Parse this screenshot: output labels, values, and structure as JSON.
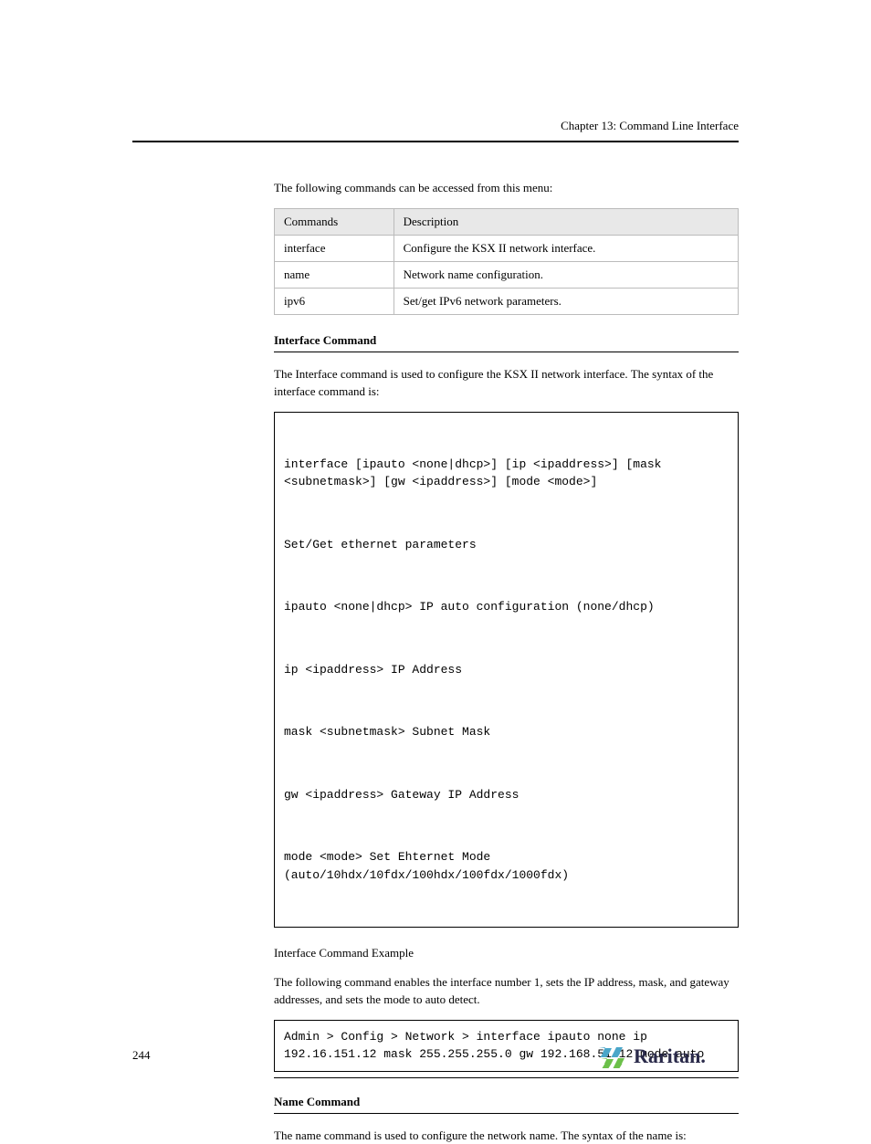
{
  "header": {
    "chapter_line": "Chapter 13: Command Line Interface"
  },
  "intro": "The following commands can be accessed from this menu:",
  "table": {
    "head": {
      "cmd": "Commands",
      "desc": "Description"
    },
    "rows": [
      {
        "cmd": "interface",
        "desc": "Configure the KSX II network interface."
      },
      {
        "cmd": "name",
        "desc": "Network name configuration."
      },
      {
        "cmd": "ipv6",
        "desc": "Set/get IPv6 network parameters."
      }
    ]
  },
  "sec1": {
    "title": "Interface Command",
    "para": "The Interface command is used to configure the KSX II network interface. The syntax of the interface command is:",
    "code": [
      "interface [ipauto <none|dhcp>] [ip <ipaddress>] [mask <subnetmask>] [gw <ipaddress>] [mode <mode>]",
      "Set/Get ethernet parameters",
      "ipauto <none|dhcp> IP auto configuration (none/dhcp)",
      "ip <ipaddress> IP Address",
      "mask <subnetmask> Subnet Mask",
      "gw <ipaddress> Gateway IP Address",
      "mode <mode> Set Ehternet Mode (auto/10hdx/10fdx/100hdx/100fdx/1000fdx)"
    ],
    "example_label": "Interface Command Example",
    "example_para": "The following command enables the interface number 1, sets the IP address, mask, and gateway addresses, and sets the mode to auto detect.",
    "example_code": "Admin > Config > Network > interface ipauto none ip 192.16.151.12 mask 255.255.255.0 gw 192.168.51.12 mode auto"
  },
  "sec2": {
    "title": "Name Command",
    "para": "The name command is used to configure the network name. The syntax of the name is:"
  },
  "footer": {
    "page": "244",
    "logo_text": "Raritan."
  }
}
